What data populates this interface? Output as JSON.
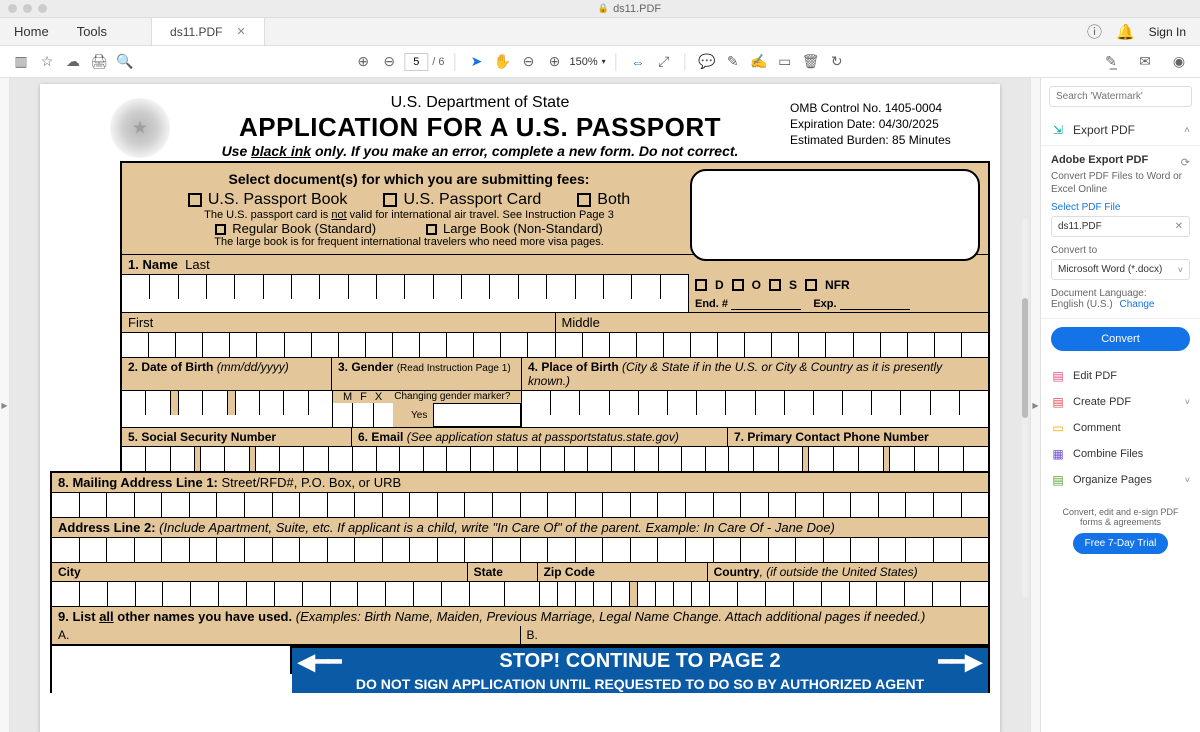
{
  "titlebar": {
    "filename": "ds11.PDF"
  },
  "topmenu": {
    "home": "Home",
    "tools": "Tools",
    "tab": "ds11.PDF",
    "signin": "Sign In"
  },
  "toolbar": {
    "page_current": "5",
    "page_total": "/ 6",
    "zoom": "150%"
  },
  "rightpanel": {
    "search_placeholder": "Search 'Watermark'",
    "export_pdf": "Export PDF",
    "adobe_export": "Adobe Export PDF",
    "adobe_export_sub": "Convert PDF Files to Word or Excel Online",
    "select_file": "Select PDF File",
    "filebox": "ds11.PDF",
    "convert_to": "Convert to",
    "convert_option": "Microsoft Word (*.docx)",
    "doc_lang_label": "Document Language:",
    "doc_lang": "English (U.S.)",
    "change": "Change",
    "convert_btn": "Convert",
    "edit_pdf": "Edit PDF",
    "create_pdf": "Create PDF",
    "comment": "Comment",
    "combine": "Combine Files",
    "organize": "Organize Pages",
    "footer_text": "Convert, edit and e-sign PDF forms & agreements",
    "trial_btn": "Free 7-Day Trial"
  },
  "doc": {
    "dept": "U.S. Department of State",
    "title": "APPLICATION FOR A U.S. PASSPORT",
    "instr_pre": "Use ",
    "instr_black": "black ink",
    "instr_post": " only. If you make an error, complete a new form. Do not correct.",
    "omb1": "OMB Control No. 1405-0004",
    "omb2": "Expiration Date: 04/30/2025",
    "omb3": "Estimated Burden: 85 Minutes",
    "select_docs": "Select document(s) for which you are submitting fees:",
    "passport_book": "U.S. Passport Book",
    "passport_card": "U.S. Passport Card",
    "both": "Both",
    "card_note_pre": "The U.S. passport card is ",
    "card_note_not": "not",
    "card_note_post": " valid for international air travel. See Instruction Page 3",
    "regular_book": "Regular Book (Standard)",
    "large_book": "Large Book (Non-Standard)",
    "large_note": "The large book is for frequent international travelers who need more visa pages.",
    "f1": "1.  Name",
    "f1_last": "Last",
    "f1_first": "First",
    "f1_middle": "Middle",
    "status_d": "D",
    "status_o": "O",
    "status_s": "S",
    "status_nfr": "NFR",
    "end_num": "End. #",
    "exp": "Exp.",
    "f2": "2.  Date of Birth",
    "f2_hint": "(mm/dd/yyyy)",
    "f3": "3.  Gender",
    "f3_hint": "(Read Instruction Page 1)",
    "f3_m": "M",
    "f3_f": "F",
    "f3_x": "X",
    "f3_sub1": "Changing gender marker?",
    "f3_sub2": "Yes",
    "f4": "4.  Place of Birth",
    "f4_hint": "(City & State if in the U.S. or City & Country as it is presently known.)",
    "f5": "5.  Social Security Number",
    "f6": "6.  Email",
    "f6_hint": "(See application status at passportstatus.state.gov)",
    "f7": "7.  Primary Contact Phone Number",
    "f8": "8.  Mailing Address Line 1:",
    "f8_hint": "Street/RFD#, P.O. Box, or URB",
    "f8b": "Address Line 2:",
    "f8b_hint": "(Include Apartment, Suite, etc. If applicant is a child, write \"In Care Of\" of the parent. Example: In Care Of - Jane Doe)",
    "city": "City",
    "state": "State",
    "zip": "Zip Code",
    "country": "Country",
    "country_hint": ", (if outside the United States)",
    "f9": "9.  List all other names you have used.",
    "f9_hint": "(Examples: Birth Name, Maiden, Previous Marriage, Legal Name Change.  Attach additional  pages if needed.)",
    "f9a": "A.",
    "f9b": "B.",
    "stop": "STOP! CONTINUE TO PAGE 2",
    "stop_sub": "DO NOT SIGN APPLICATION UNTIL REQUESTED TO DO SO BY AUTHORIZED AGENT"
  }
}
